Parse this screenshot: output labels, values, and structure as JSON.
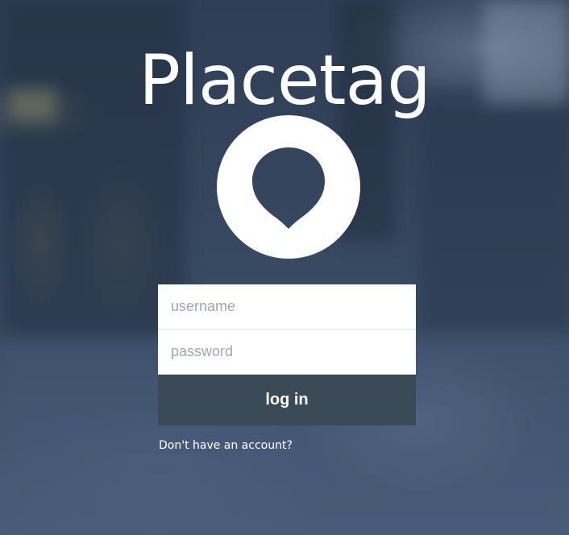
{
  "app": {
    "title": "Placetag"
  },
  "login_form": {
    "username_placeholder": "username",
    "password_placeholder": "password",
    "submit_label": "log in",
    "signup_link": "Don't have an account?"
  },
  "icons": {
    "logo": "location-pin-icon"
  },
  "colors": {
    "button_bg": "#3b4a57",
    "title_text": "#ffffff",
    "field_bg": "#ffffff",
    "placeholder_text": "#a3a7ab"
  }
}
